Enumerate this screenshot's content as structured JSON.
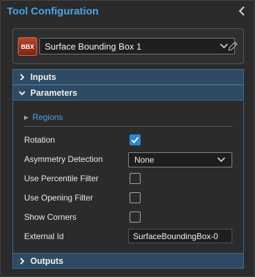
{
  "panel": {
    "title": "Tool Configuration"
  },
  "tool": {
    "badge": "BBX",
    "name": "Surface Bounding Box 1",
    "badge_color": "#b7472a"
  },
  "sections": {
    "inputs": "Inputs",
    "parameters": "Parameters",
    "outputs": "Outputs"
  },
  "parameters": {
    "regions_label": "Regions",
    "rotation_label": "Rotation",
    "rotation_checked": true,
    "asymmetry_label": "Asymmetry Detection",
    "asymmetry_value": "None",
    "percentile_label": "Use Percentile Filter",
    "percentile_checked": false,
    "opening_label": "Use Opening Filter",
    "opening_checked": false,
    "corners_label": "Show Corners",
    "corners_checked": false,
    "external_id_label": "External Id",
    "external_id_value": "SurfaceBoundingBox-0"
  },
  "colors": {
    "accent": "#4aa3e8",
    "section_header": "#2f4a63",
    "checkbox_checked": "#2f86d6"
  }
}
